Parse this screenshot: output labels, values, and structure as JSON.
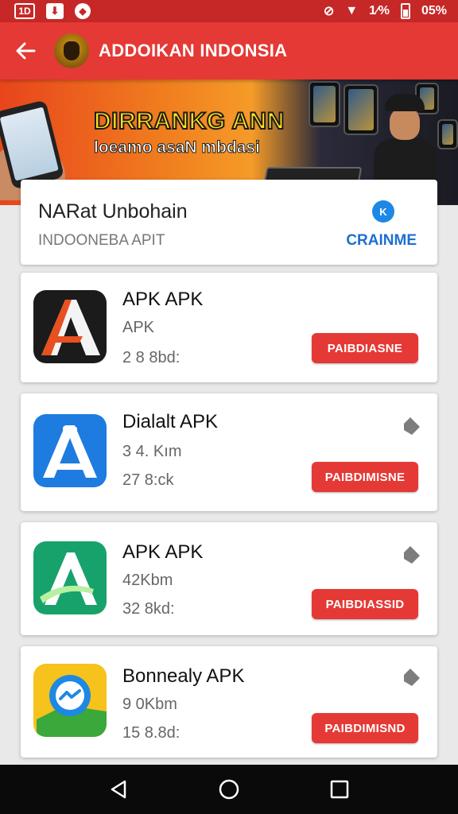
{
  "status_bar": {
    "left_icons": [
      "1⃞",
      "⊞",
      "◉"
    ],
    "left_label_1": "1D",
    "signal_text": "1⁄%",
    "battery_text": "05%"
  },
  "app_bar": {
    "title": "ADDOIKAN INDONSIA",
    "back_icon": "arrow-left-icon",
    "logo_icon": "garuda-emblem-icon"
  },
  "banner": {
    "title": "DIRRANKG ANN",
    "subtitle": "loeamo asaN mbdasi"
  },
  "header_card": {
    "title": "NARat Unbohain",
    "subtitle": "INDOONEBA APIT",
    "badge": "K",
    "link": "CRAINME"
  },
  "apps": [
    {
      "name": "APK APK",
      "line1": "APK",
      "line2": "2 8 8bd:",
      "button": "PAIBDIASNE",
      "icon": "black-a-app-icon",
      "colors": {
        "bg": "#1b1b1b",
        "accent": "#e8501f"
      }
    },
    {
      "name": "Dialalt APK",
      "line1": "3 4. Kım",
      "line2": "27 8:ck",
      "button": "PAIBDIMISNE",
      "icon": "blue-a-app-icon",
      "colors": {
        "bg": "#1e7be0",
        "accent": "#ffffff"
      }
    },
    {
      "name": "APK APK",
      "line1": "42Kbm",
      "line2": "32 8kd:",
      "button": "PAIBDIASSID",
      "icon": "green-a-app-icon",
      "colors": {
        "bg": "#18a26b",
        "accent": "#ffffff"
      }
    },
    {
      "name": "Bonnealy APK",
      "line1": "9 0Kbm",
      "line2": "15 8.8d:",
      "button": "PAIBDIMISND",
      "icon": "yellow-messenger-app-icon",
      "colors": {
        "bg": "#f6c21c",
        "accent": "#1e88e5"
      }
    }
  ],
  "nav_bar": {
    "back": "nav-back-icon",
    "home": "nav-home-icon",
    "recents": "nav-recents-icon"
  },
  "theme": {
    "primary": "#e53935",
    "status": "#c62828",
    "link": "#1e6fd0"
  }
}
